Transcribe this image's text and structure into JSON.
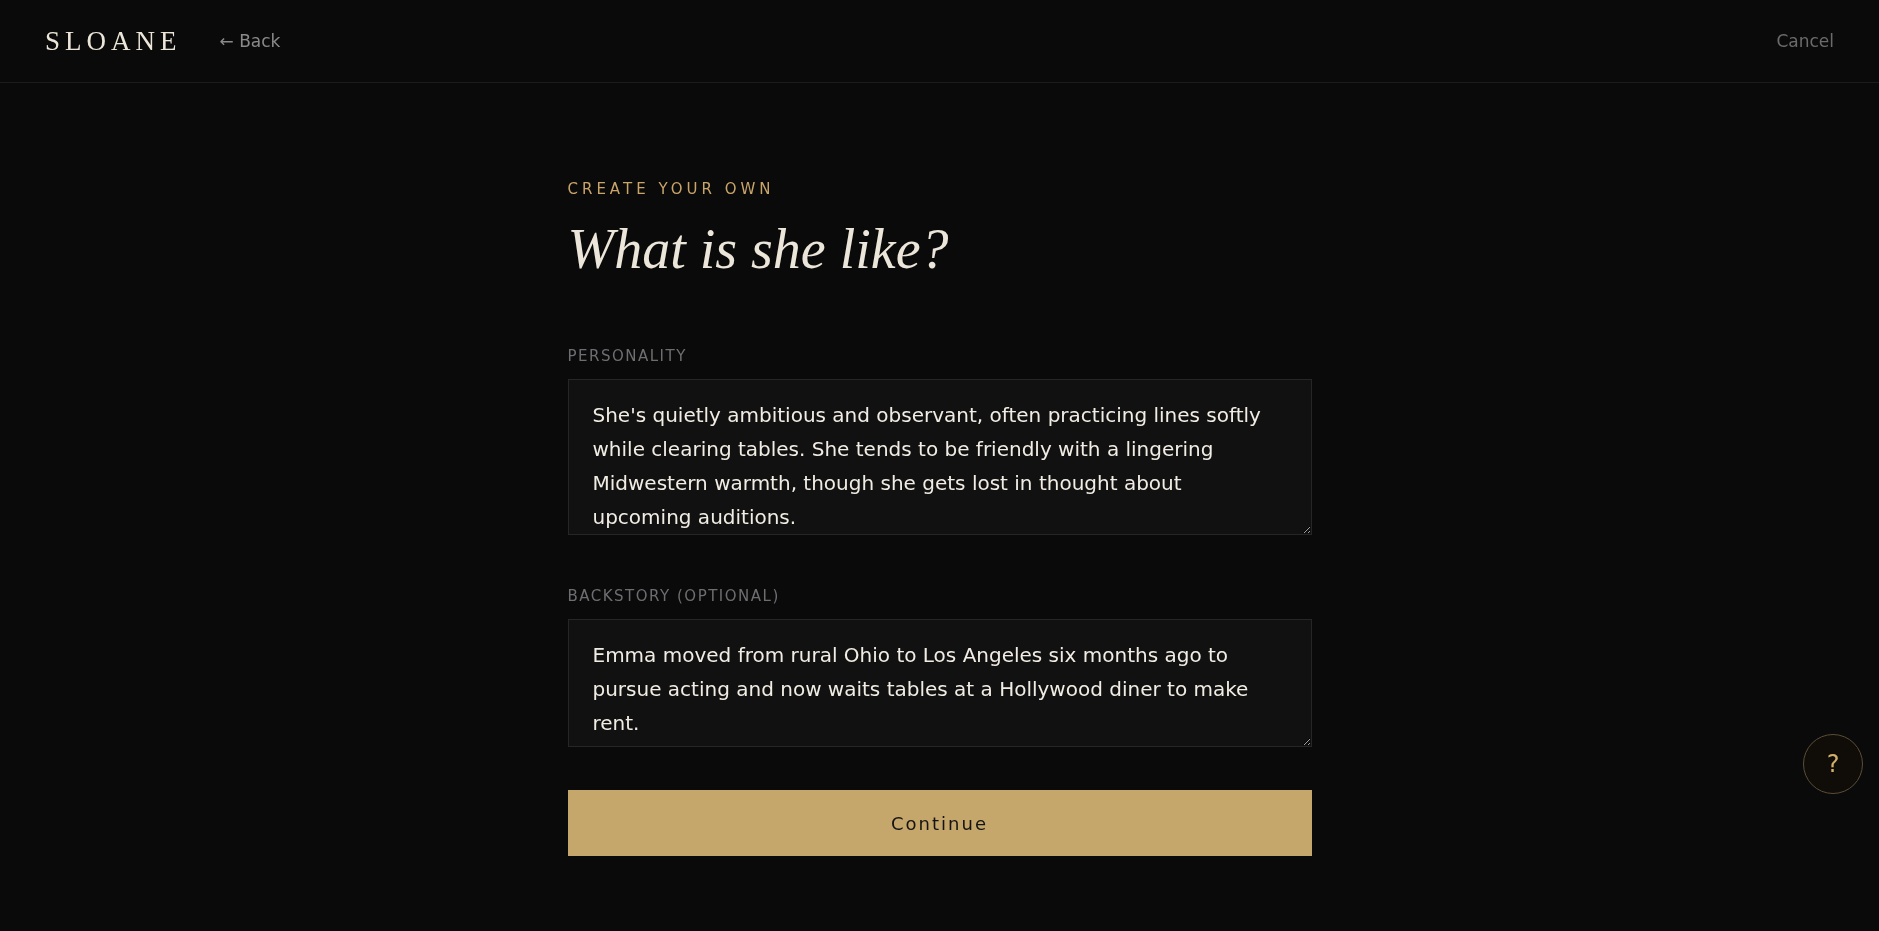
{
  "header": {
    "logo": "SLOANE",
    "back": "← Back",
    "cancel": "Cancel"
  },
  "eyebrow": "CREATE YOUR OWN",
  "title": "What is she like?",
  "fields": [
    {
      "label": "PERSONALITY",
      "value": "She's quietly ambitious and observant, often practicing lines softly while clearing tables. She tends to be friendly with a lingering Midwestern warmth, though she gets lost in thought about upcoming auditions."
    },
    {
      "label": "BACKSTORY (OPTIONAL)",
      "value": "Emma moved from rural Ohio to Los Angeles six months ago to pursue acting and now waits tables at a Hollywood diner to make rent."
    }
  ],
  "continue": "Continue",
  "help": "?"
}
